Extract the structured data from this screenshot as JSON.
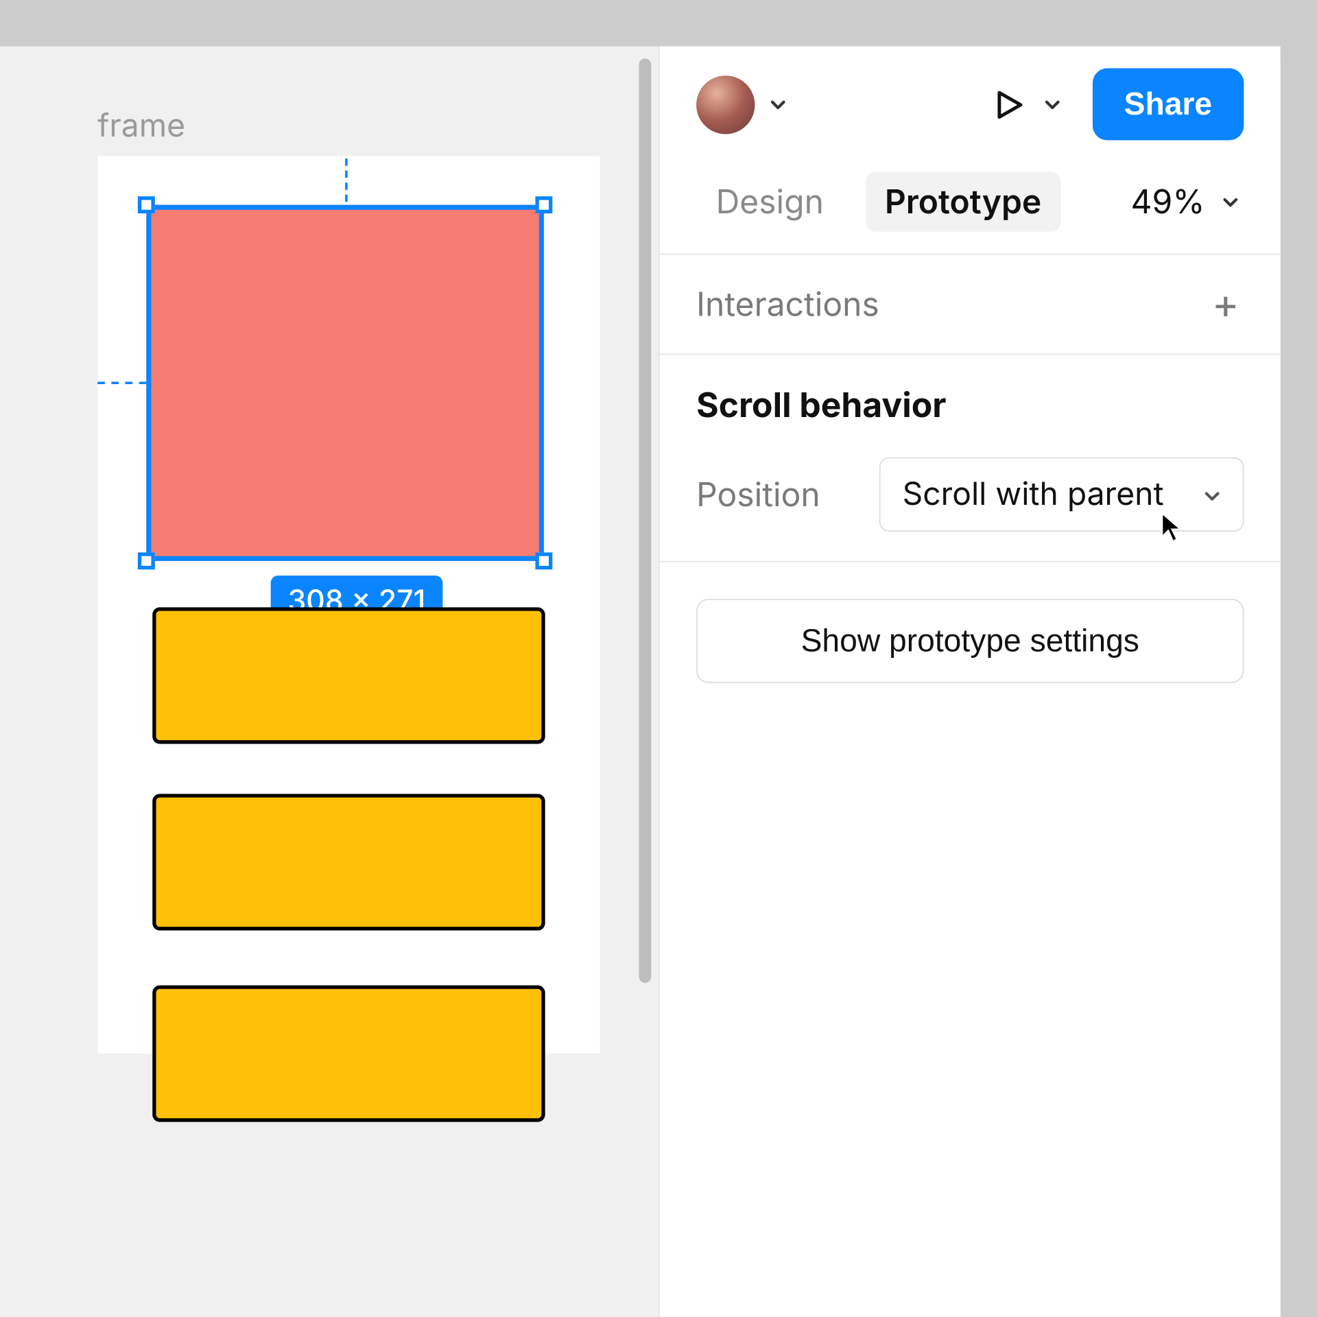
{
  "canvas": {
    "frame_label": "frame",
    "selection_size": "308 × 271"
  },
  "header": {
    "share_label": "Share",
    "zoom": "49%"
  },
  "tabs": {
    "design": "Design",
    "prototype": "Prototype",
    "active": "Prototype"
  },
  "interactions": {
    "heading": "Interactions"
  },
  "scroll_behavior": {
    "heading": "Scroll behavior",
    "position_label": "Position",
    "position_value": "Scroll with parent"
  },
  "footer": {
    "show_prototype_settings": "Show prototype settings"
  },
  "colors": {
    "accent": "#0a84ff",
    "selected_fill": "#f77c72",
    "bar_fill": "#ffc107"
  }
}
